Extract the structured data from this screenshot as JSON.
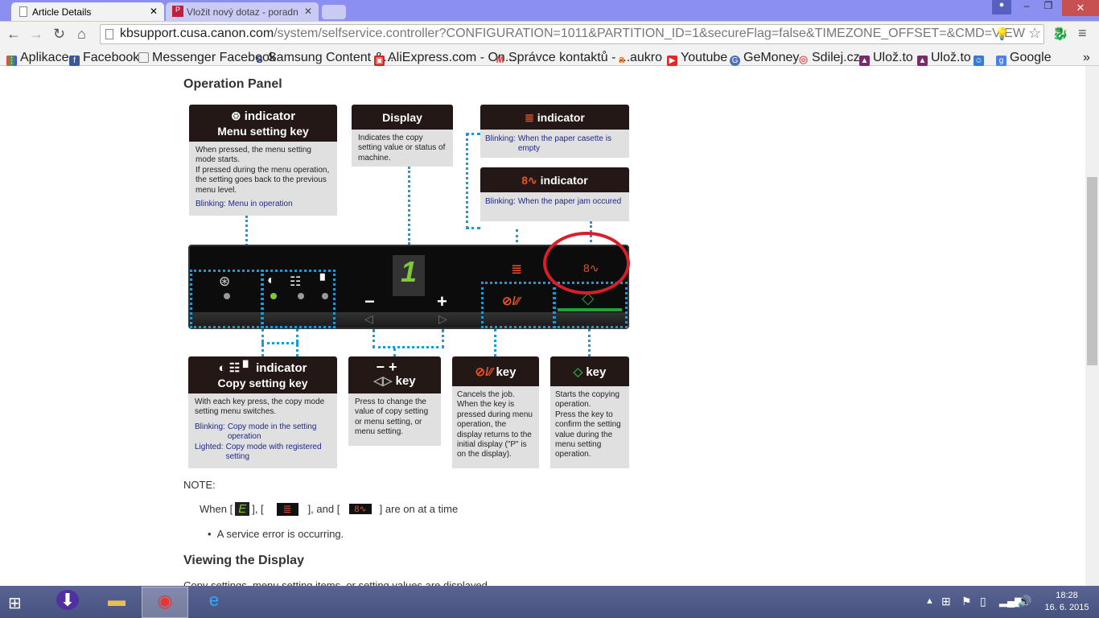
{
  "browser": {
    "tabs": [
      {
        "label": "Article Details",
        "active": true
      },
      {
        "label": "Vložit nový dotaz - poradn",
        "active": false
      }
    ],
    "url_host": "kbsupport.cusa.canon.com",
    "url_path": "/system/selfservice.controller?CONFIGURATION=1011&PARTITION_ID=1&secureFlag=false&TIMEZONE_OFFSET=&CMD=VIEW",
    "bookmarks": [
      "Aplikace",
      "Facebook",
      "Messenger Facebook",
      "Samsung Content &...",
      "AliExpress.com - On...",
      "Správce kontaktů - ...",
      "aukro",
      "Youtube",
      "GeMoney",
      "Sdilej.cz",
      "Ulož.to",
      "Ulož.to",
      "",
      "Google"
    ],
    "more": "»"
  },
  "page": {
    "heading": "Operation Panel",
    "menu_box": {
      "title1": "indicator",
      "title2": "Menu setting key",
      "body": "When pressed, the menu setting mode starts.\nIf pressed during the menu operation, the setting goes back to the previous menu level.",
      "blink": "Blinking: Menu in operation"
    },
    "display_box": {
      "title": "Display",
      "body": "Indicates the copy setting value or status of machine."
    },
    "paper_box": {
      "title": "indicator",
      "blink_label": "Blinking:",
      "blink": "When the paper casette is empty"
    },
    "jam_box": {
      "title": "indicator",
      "blink_label": "Blinking:",
      "blink": "When the paper jam occured"
    },
    "panel": {
      "display_digit": "1",
      "minus": "−",
      "plus": "+"
    },
    "copy_box": {
      "title1": "indicator",
      "title2": "Copy setting key",
      "body": "With each key press, the copy mode setting menu switches.",
      "blink_label": "Blinking:",
      "blink": "Copy mode in the setting operation",
      "lit_label": "Lighted:",
      "lit": "Copy mode with registered setting"
    },
    "plusminus_box": {
      "title": "key",
      "symbols": "− +",
      "body": "Press to change the value of copy setting or menu setting, or menu setting."
    },
    "stop_box": {
      "title": "key",
      "body": "Cancels the job.\nWhen the key is pressed during menu operation, the display returns to the initial display (\"P\" is on the display)."
    },
    "start_box": {
      "title": "key",
      "body": "Starts the copying operation.\nPress the key to confirm the setting value during the menu setting operation."
    },
    "note": "NOTE:",
    "note_when": "When [",
    "note_sep1": "], [",
    "note_sep2": "], and [",
    "note_end": "] are on at a time",
    "note_e": "E",
    "bullet": "A service error is occurring.",
    "heading2": "Viewing the Display",
    "cut_text": "Copy settings, menu setting items, or setting values are displayed."
  },
  "taskbar": {
    "time": "18:28",
    "date": "16. 6. 2015"
  }
}
